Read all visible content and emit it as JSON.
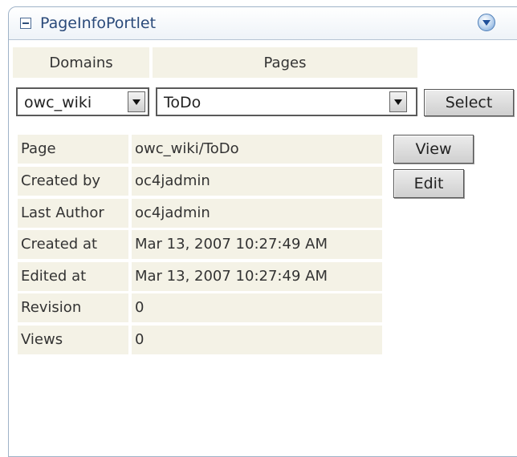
{
  "portlet": {
    "title": "PageInfoPortlet"
  },
  "headers": {
    "domains": "Domains",
    "pages": "Pages"
  },
  "domain_select": {
    "selected": "owc_wiki"
  },
  "page_select": {
    "selected": "ToDo"
  },
  "buttons": {
    "select": "Select",
    "view": "View",
    "edit": "Edit"
  },
  "info": [
    {
      "label": "Page",
      "value": "owc_wiki/ToDo"
    },
    {
      "label": "Created by",
      "value": "oc4jadmin"
    },
    {
      "label": "Last Author",
      "value": "oc4jadmin"
    },
    {
      "label": "Created at",
      "value": "Mar 13, 2007 10:27:49 AM"
    },
    {
      "label": "Edited at",
      "value": "Mar 13, 2007 10:27:49 AM"
    },
    {
      "label": "Revision",
      "value": "0"
    },
    {
      "label": "Views",
      "value": "0"
    }
  ],
  "icons": {
    "collapse": "minus-box-icon",
    "menu": "circle-chevron-down-icon"
  },
  "colors": {
    "title_text": "#2a4a7a",
    "cell_background": "#f4f2e6",
    "border": "#9fb3c8"
  }
}
